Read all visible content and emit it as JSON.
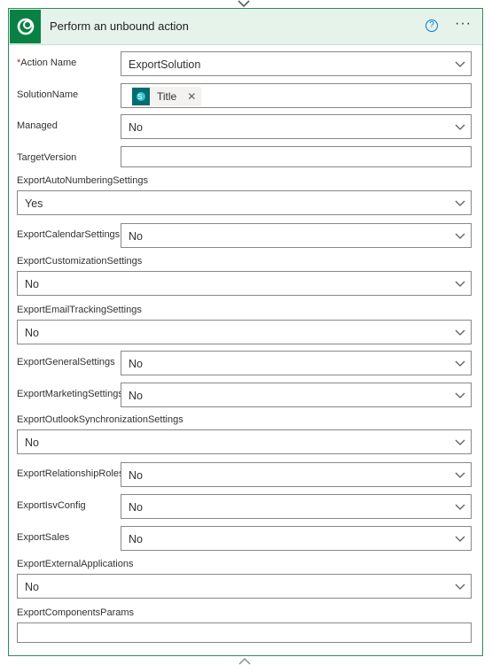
{
  "card": {
    "title": "Perform an unbound action",
    "help_glyph": "?",
    "more_glyph": "···",
    "logo_icon": "dataverse-logo-icon"
  },
  "fields": [
    {
      "label": "Action Name",
      "required": true,
      "type": "dropdown",
      "value": "ExportSolution",
      "placement": "inline"
    },
    {
      "label": "SolutionName",
      "type": "token",
      "token": {
        "text": "Title",
        "icon": "sharepoint-icon"
      },
      "placement": "inline"
    },
    {
      "label": "Managed",
      "type": "dropdown",
      "value": "No",
      "placement": "inline"
    },
    {
      "label": "TargetVersion",
      "type": "text",
      "value": "",
      "placement": "inline"
    },
    {
      "label": "ExportAutoNumberingSettings",
      "type": "dropdown",
      "value": "Yes",
      "placement": "stacked"
    },
    {
      "label": "ExportCalendarSettings",
      "type": "dropdown",
      "value": "No",
      "placement": "inline"
    },
    {
      "label": "ExportCustomizationSettings",
      "type": "dropdown",
      "value": "No",
      "placement": "stacked"
    },
    {
      "label": "ExportEmailTrackingSettings",
      "type": "dropdown",
      "value": "No",
      "placement": "stacked"
    },
    {
      "label": "ExportGeneralSettings",
      "type": "dropdown",
      "value": "No",
      "placement": "inline"
    },
    {
      "label": "ExportMarketingSettings",
      "type": "dropdown",
      "value": "No",
      "placement": "inline"
    },
    {
      "label": "ExportOutlookSynchronizationSettings",
      "type": "dropdown",
      "value": "No",
      "placement": "stacked"
    },
    {
      "label": "ExportRelationshipRoles",
      "type": "dropdown",
      "value": "No",
      "placement": "inline"
    },
    {
      "label": "ExportIsvConfig",
      "type": "dropdown",
      "value": "No",
      "placement": "inline"
    },
    {
      "label": "ExportSales",
      "type": "dropdown",
      "value": "No",
      "placement": "inline"
    },
    {
      "label": "ExportExternalApplications",
      "type": "dropdown",
      "value": "No",
      "placement": "stacked"
    },
    {
      "label": "ExportComponentsParams",
      "type": "text",
      "value": "",
      "placement": "stacked"
    }
  ],
  "colors": {
    "header_bg": "#e6f3eb",
    "card_border": "#2f8a5a",
    "logo_bg": "#088142",
    "help_blue": "#0078d4",
    "required_red": "#a4262c",
    "token_icon_bg": "#036c70"
  }
}
